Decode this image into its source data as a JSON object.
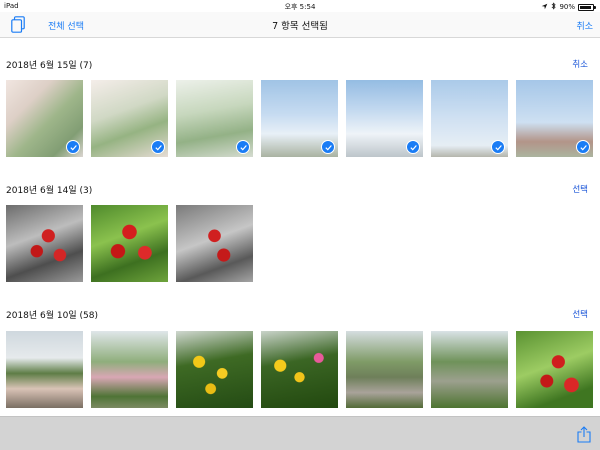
{
  "status_bar": {
    "device": "iPad",
    "time": "오후 5:54",
    "battery_percent": 90,
    "battery_label": "90%",
    "icons": [
      "location-icon",
      "bluetooth-icon",
      "battery-icon"
    ]
  },
  "nav": {
    "albums_icon": "albums-icon",
    "select_all_label": "전체 선택",
    "title": "7 항목 선택됨",
    "cancel_label": "취소"
  },
  "sections": [
    {
      "date": "2018년 6월 15일 (7)",
      "action_label": "취소",
      "photos": [
        {
          "selected": true
        },
        {
          "selected": true
        },
        {
          "selected": true
        },
        {
          "selected": true
        },
        {
          "selected": true
        },
        {
          "selected": true
        },
        {
          "selected": true
        }
      ]
    },
    {
      "date": "2018년 6월 14일 (3)",
      "action_label": "선택",
      "photos": [
        {
          "selected": false
        },
        {
          "selected": false
        },
        {
          "selected": false
        }
      ]
    },
    {
      "date": "2018년 6월 10일 (58)",
      "action_label": "선택",
      "photos": [
        {
          "selected": false
        },
        {
          "selected": false
        },
        {
          "selected": false
        },
        {
          "selected": false
        },
        {
          "selected": false
        },
        {
          "selected": false
        },
        {
          "selected": false
        }
      ]
    }
  ],
  "toolbar": {
    "share_icon": "share-icon"
  },
  "colors": {
    "accent": "#1a7cf5",
    "section_action": "#1a55d8",
    "toolbar_bg": "#d3d3d3"
  }
}
